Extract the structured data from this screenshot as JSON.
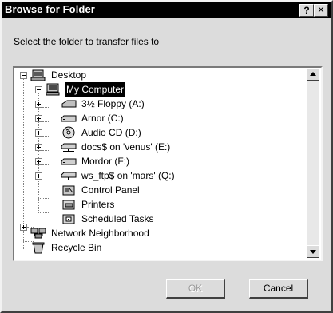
{
  "window": {
    "title": "Browse for Folder",
    "help_label": "?",
    "close_label": "✕"
  },
  "prompt": "Select the folder to transfer files to",
  "tree": {
    "items": [
      {
        "label": "Desktop",
        "icon": "desktop-icon"
      },
      {
        "label": "My Computer",
        "icon": "computer-icon",
        "selected": true
      },
      {
        "label": "3½ Floppy (A:)",
        "icon": "floppy-drive-icon"
      },
      {
        "label": "Arnor (C:)",
        "icon": "hard-drive-icon"
      },
      {
        "label": "Audio CD (D:)",
        "icon": "cd-drive-icon"
      },
      {
        "label": "docs$ on 'venus' (E:)",
        "icon": "network-drive-icon"
      },
      {
        "label": "Mordor (F:)",
        "icon": "hard-drive-icon"
      },
      {
        "label": "ws_ftp$ on 'mars' (Q:)",
        "icon": "network-drive-icon"
      },
      {
        "label": "Control Panel",
        "icon": "control-panel-icon"
      },
      {
        "label": "Printers",
        "icon": "printer-folder-icon"
      },
      {
        "label": "Scheduled Tasks",
        "icon": "scheduled-tasks-icon"
      },
      {
        "label": "Network Neighborhood",
        "icon": "network-icon"
      },
      {
        "label": "Recycle Bin",
        "icon": "recycle-bin-icon"
      }
    ]
  },
  "buttons": {
    "ok_label": "OK",
    "cancel_label": "Cancel"
  }
}
